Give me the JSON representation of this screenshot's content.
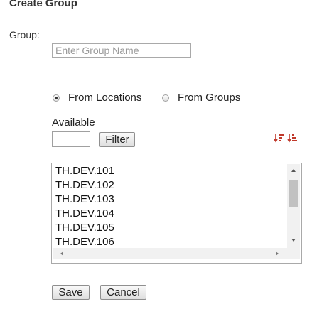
{
  "title": "Create Group",
  "group": {
    "label": "Group:",
    "placeholder": "Enter Group Name",
    "value": ""
  },
  "source": {
    "options": [
      {
        "label": "From Locations",
        "checked": true
      },
      {
        "label": "From Groups",
        "checked": false
      }
    ]
  },
  "available": {
    "label": "Available",
    "filter_value": "",
    "filter_button": "Filter",
    "sort_icons": [
      "sort-descending-icon",
      "sort-ascending-icon"
    ],
    "accent_color": "#c0392b",
    "items": [
      "TH.DEV.101",
      "TH.DEV.102",
      "TH.DEV.103",
      "TH.DEV.104",
      "TH.DEV.105",
      "TH.DEV.106"
    ]
  },
  "actions": {
    "save": "Save",
    "cancel": "Cancel"
  }
}
